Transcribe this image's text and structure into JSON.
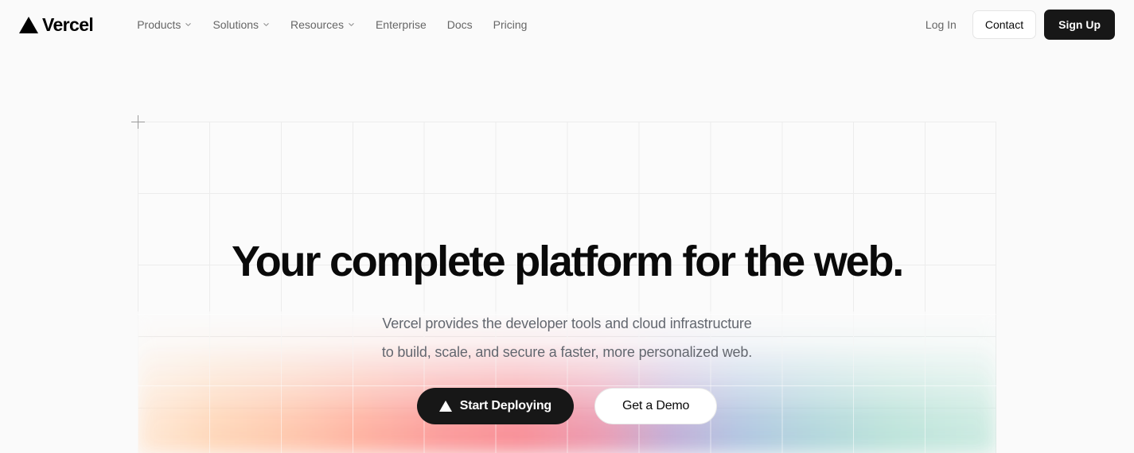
{
  "navbar": {
    "brand": {
      "name": "Vercel",
      "logo_icon": "vercel-triangle-icon"
    },
    "links": [
      {
        "label": "Products",
        "has_dropdown": true,
        "icon": "chevron-down-icon"
      },
      {
        "label": "Solutions",
        "has_dropdown": true,
        "icon": "chevron-down-icon"
      },
      {
        "label": "Resources",
        "has_dropdown": true,
        "icon": "chevron-down-icon"
      },
      {
        "label": "Enterprise",
        "has_dropdown": false
      },
      {
        "label": "Docs",
        "has_dropdown": false
      },
      {
        "label": "Pricing",
        "has_dropdown": false
      }
    ],
    "login_label": "Log In",
    "contact_label": "Contact",
    "signup_label": "Sign Up"
  },
  "hero": {
    "title": "Your complete platform for the web.",
    "subtitle_line1": "Vercel provides the developer tools and cloud infrastructure",
    "subtitle_line2": "to build, scale, and secure a faster, more personalized web.",
    "primary_cta": {
      "label": "Start Deploying",
      "icon": "vercel-triangle-icon"
    },
    "secondary_cta": {
      "label": "Get a Demo"
    }
  },
  "colors": {
    "page_background": "#fafafa",
    "grid_line": "#ececec",
    "text_primary": "#0a0a0a",
    "text_muted": "#666666",
    "subtitle": "#63676f",
    "button_dark": "#171717",
    "button_light": "#ffffff",
    "border": "#e5e5e5",
    "crosshair": "#9b9b9b",
    "gradient_peach": "#ffd2b0",
    "gradient_pink": "#fb8d8d",
    "gradient_purple": "#bba4d2",
    "gradient_blue": "#a8bede",
    "gradient_teal": "#b4e0d6"
  }
}
